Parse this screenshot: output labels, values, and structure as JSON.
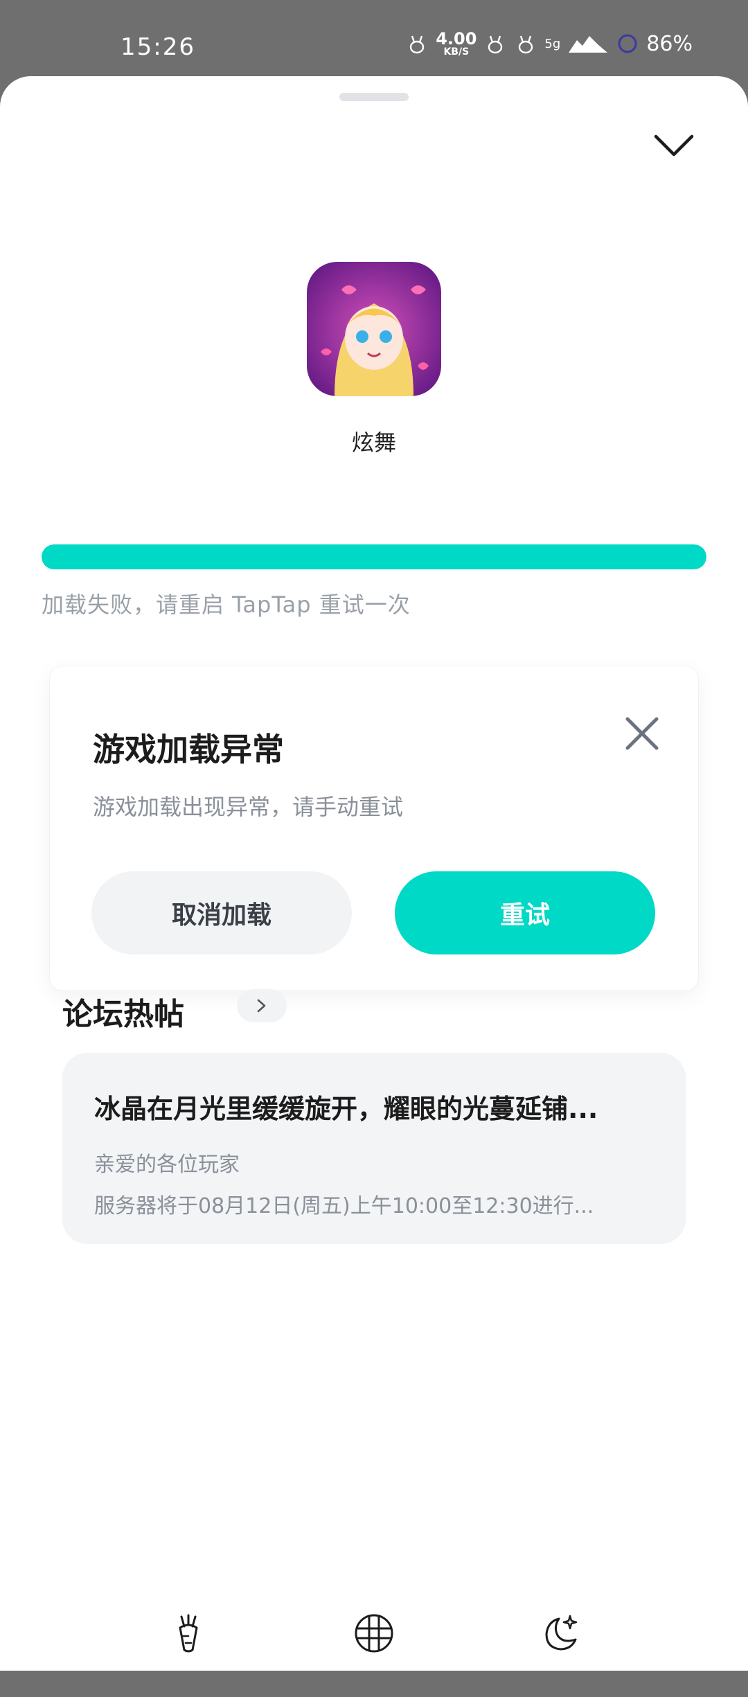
{
  "status_bar": {
    "time": "15:26",
    "net_speed": "4.00",
    "net_unit": "KB/S",
    "signal": "5g",
    "battery": "86%"
  },
  "app": {
    "name": "炫舞"
  },
  "progress": {
    "value": 1.0,
    "message": "加载失败，请重启 TapTap 重试一次"
  },
  "dialog": {
    "title": "游戏加载异常",
    "message": "游戏加载出现异常，请手动重试",
    "cancel_label": "取消加载",
    "retry_label": "重试"
  },
  "forum": {
    "title": "论坛热帖",
    "post": {
      "title": "冰晶在月光里缓缓旋开，耀眼的光蔓延铺...",
      "line1": "亲爱的各位玩家",
      "line2": "服务器将于08月12日(周五)上午10:00至12:30进行..."
    }
  },
  "colors": {
    "accent": "#00d9c5",
    "status_bar_bg": "#6f6f6f"
  },
  "icons": {
    "collapse": "chevron-down-icon",
    "close": "close-icon",
    "nav_left": "carrot-icon",
    "nav_center": "grid-circle-icon",
    "nav_right": "moon-star-icon"
  }
}
